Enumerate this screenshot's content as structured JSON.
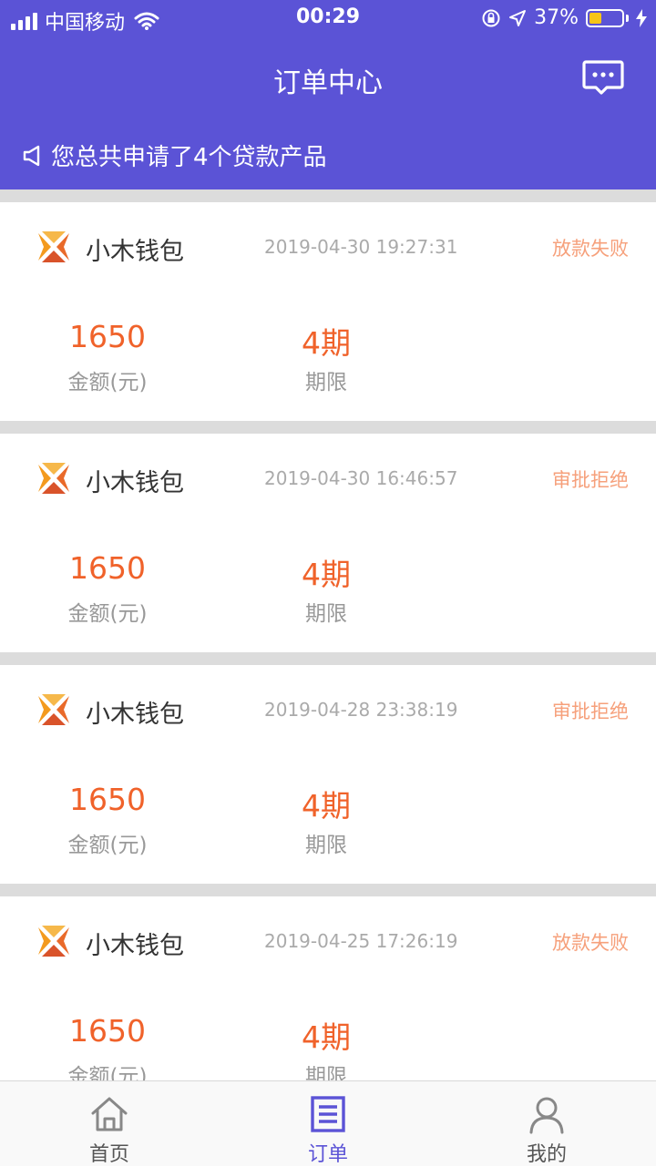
{
  "status_bar": {
    "carrier": "中国移动",
    "time": "00:29",
    "battery": "37%",
    "battery_level": 0.37
  },
  "header": {
    "title": "订单中心",
    "message_icon": "chat-bubble-icon"
  },
  "notice": {
    "text": "您总共申请了4个贷款产品",
    "icon": "megaphone-icon"
  },
  "orders": [
    {
      "name": "小木钱包",
      "time": "2019-04-30 19:27:31",
      "status": "放款失败",
      "amount": "1650",
      "amount_label": "金额(元)",
      "term": "4期",
      "term_label": "期限"
    },
    {
      "name": "小木钱包",
      "time": "2019-04-30 16:46:57",
      "status": "审批拒绝",
      "amount": "1650",
      "amount_label": "金额(元)",
      "term": "4期",
      "term_label": "期限"
    },
    {
      "name": "小木钱包",
      "time": "2019-04-28 23:38:19",
      "status": "审批拒绝",
      "amount": "1650",
      "amount_label": "金额(元)",
      "term": "4期",
      "term_label": "期限"
    },
    {
      "name": "小木钱包",
      "time": "2019-04-25 17:26:19",
      "status": "放款失败",
      "amount": "1650",
      "amount_label": "金额(元)",
      "term": "4期",
      "term_label": "期限"
    }
  ],
  "tabbar": {
    "items": [
      {
        "label": "首页",
        "icon": "home-icon",
        "active": false
      },
      {
        "label": "订单",
        "icon": "order-list-icon",
        "active": true
      },
      {
        "label": "我的",
        "icon": "user-icon",
        "active": false
      }
    ]
  },
  "colors": {
    "header_bg": "#5b53d6",
    "accent_orange": "#f0622a",
    "status_text": "#f6a07b",
    "tab_active": "#5b53d6",
    "tab_inactive": "#888888"
  }
}
